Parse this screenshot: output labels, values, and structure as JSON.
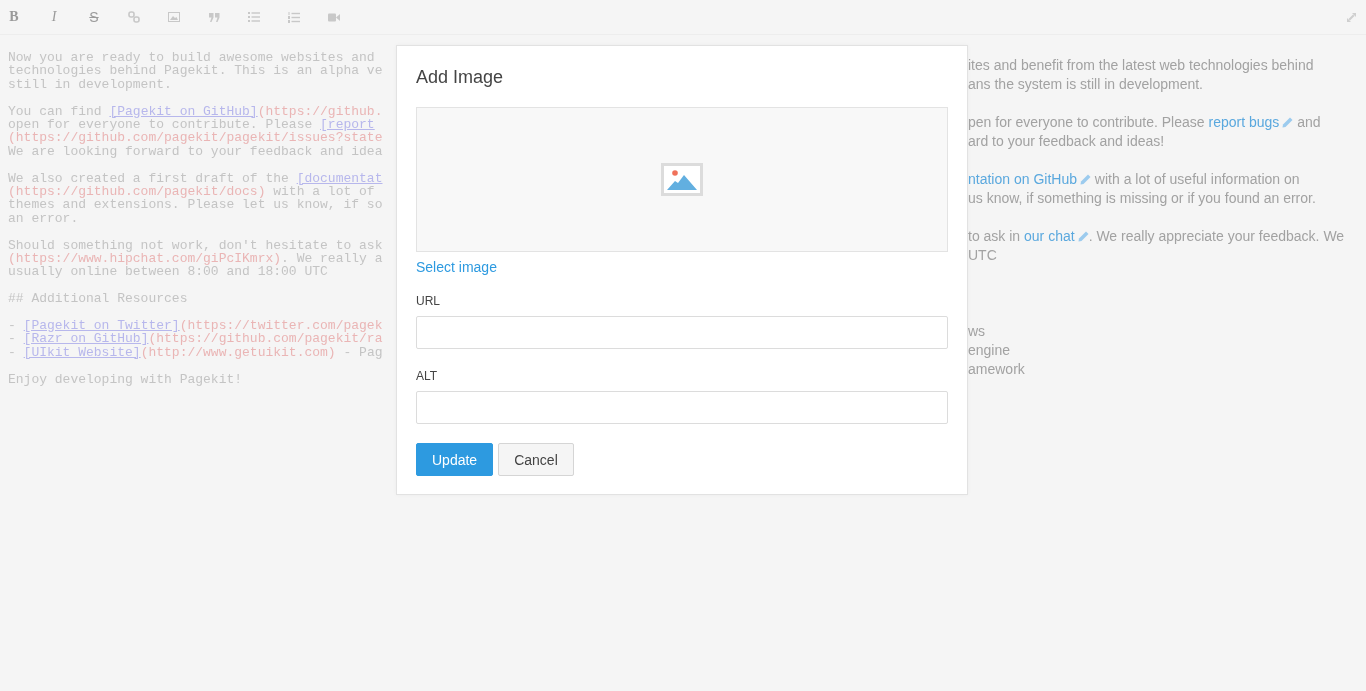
{
  "toolbar": {
    "buttons": [
      {
        "kind": "bold",
        "label": "B"
      },
      {
        "kind": "italic",
        "label": "I"
      },
      {
        "kind": "strike",
        "label": "S"
      },
      {
        "kind": "link"
      },
      {
        "kind": "image"
      },
      {
        "kind": "quote"
      },
      {
        "kind": "bullets"
      },
      {
        "kind": "numbers"
      },
      {
        "kind": "video"
      }
    ]
  },
  "source": {
    "paragraphs": [
      [
        [
          {
            "kind": "text",
            "text": "Now you are ready to build awesome websites and"
          }
        ],
        [
          {
            "kind": "text",
            "text": "technologies behind Pagekit. This is an alpha ve"
          }
        ],
        [
          {
            "kind": "text",
            "text": "still in development."
          }
        ]
      ],
      [
        [
          {
            "kind": "text",
            "text": "You can find "
          },
          {
            "kind": "link",
            "text": "[Pagekit on GitHub]"
          },
          {
            "kind": "url",
            "text": "(https://github."
          }
        ],
        [
          {
            "kind": "text",
            "text": "open for everyone to contribute. Please "
          },
          {
            "kind": "link",
            "text": "[report"
          }
        ],
        [
          {
            "kind": "url",
            "text": "(https://github.com/pagekit/pagekit/issues?state"
          }
        ],
        [
          {
            "kind": "text",
            "text": "We are looking forward to your feedback and idea"
          }
        ]
      ],
      [
        [
          {
            "kind": "text",
            "text": "We also created a first draft of the "
          },
          {
            "kind": "link",
            "text": "[documentat"
          }
        ],
        [
          {
            "kind": "url",
            "text": "(https://github.com/pagekit/docs)"
          },
          {
            "kind": "text",
            "text": " with a lot of"
          }
        ],
        [
          {
            "kind": "text",
            "text": "themes and extensions. Please let us know, if so"
          }
        ],
        [
          {
            "kind": "text",
            "text": "an error."
          }
        ]
      ],
      [
        [
          {
            "kind": "text",
            "text": "Should something not work, don't hesitate to ask"
          }
        ],
        [
          {
            "kind": "url",
            "text": "(https://www.hipchat.com/giPcIKmrx)"
          },
          {
            "kind": "text",
            "text": ". We really a"
          }
        ],
        [
          {
            "kind": "text",
            "text": "usually online between 8:00 and 18:00 UTC"
          }
        ]
      ],
      [
        [
          {
            "kind": "text",
            "text": "## Additional Resources"
          }
        ]
      ],
      [
        [
          {
            "kind": "text",
            "text": "- "
          },
          {
            "kind": "link",
            "text": "[Pagekit on Twitter]"
          },
          {
            "kind": "url",
            "text": "(https://twitter.com/pagek"
          }
        ],
        [
          {
            "kind": "text",
            "text": "- "
          },
          {
            "kind": "link",
            "text": "[Razr on GitHub]"
          },
          {
            "kind": "url",
            "text": "(https://github.com/pagekit/ra"
          }
        ],
        [
          {
            "kind": "text",
            "text": "- "
          },
          {
            "kind": "link",
            "text": "[UIkit Website]"
          },
          {
            "kind": "url",
            "text": "(http://www.getuikit.com)"
          },
          {
            "kind": "text",
            "text": " - Pag"
          }
        ]
      ],
      [
        [
          {
            "kind": "text",
            "text": "Enjoy developing with Pagekit!"
          }
        ]
      ]
    ]
  },
  "preview": {
    "paragraphs": [
      {
        "kind": "paragraph",
        "lines": [
          [
            {
              "kind": "text",
              "text": "ites and benefit from the latest web technologies behind"
            }
          ],
          [
            {
              "kind": "text",
              "text": "ans the system is still in development."
            }
          ]
        ]
      },
      {
        "kind": "paragraph",
        "lines": [
          [
            {
              "kind": "text",
              "text": "pen for everyone to contribute. Please "
            },
            {
              "kind": "link",
              "text": "report bugs"
            },
            {
              "kind": "text",
              "text": " and"
            }
          ],
          [
            {
              "kind": "text",
              "text": "ard to your feedback and ideas!"
            }
          ]
        ]
      },
      {
        "kind": "paragraph",
        "lines": [
          [
            {
              "kind": "link",
              "text": "ntation on GitHub"
            },
            {
              "kind": "text",
              "text": " with a lot of useful information on"
            }
          ],
          [
            {
              "kind": "text",
              "text": "us know, if something is missing or if you found an error."
            }
          ]
        ]
      },
      {
        "kind": "paragraph",
        "lines": [
          [
            {
              "kind": "text",
              "text": "to ask in "
            },
            {
              "kind": "link",
              "text": "our chat"
            },
            {
              "kind": "text",
              "text": ". We really appreciate your feedback. We"
            }
          ],
          [
            {
              "kind": "text",
              "text": "UTC"
            }
          ]
        ]
      },
      {
        "kind": "list",
        "lines": [
          [
            {
              "kind": "text",
              "text": "ws"
            }
          ],
          [
            {
              "kind": "text",
              "text": "engine"
            }
          ],
          [
            {
              "kind": "text",
              "text": "amework"
            }
          ]
        ]
      }
    ]
  },
  "dialog": {
    "title": "Add Image",
    "select_link": "Select image",
    "fields": [
      {
        "label": "URL"
      },
      {
        "label": "ALT"
      }
    ],
    "buttons": [
      {
        "kind": "primary",
        "label": "Update"
      },
      {
        "kind": "default",
        "label": "Cancel"
      }
    ]
  }
}
